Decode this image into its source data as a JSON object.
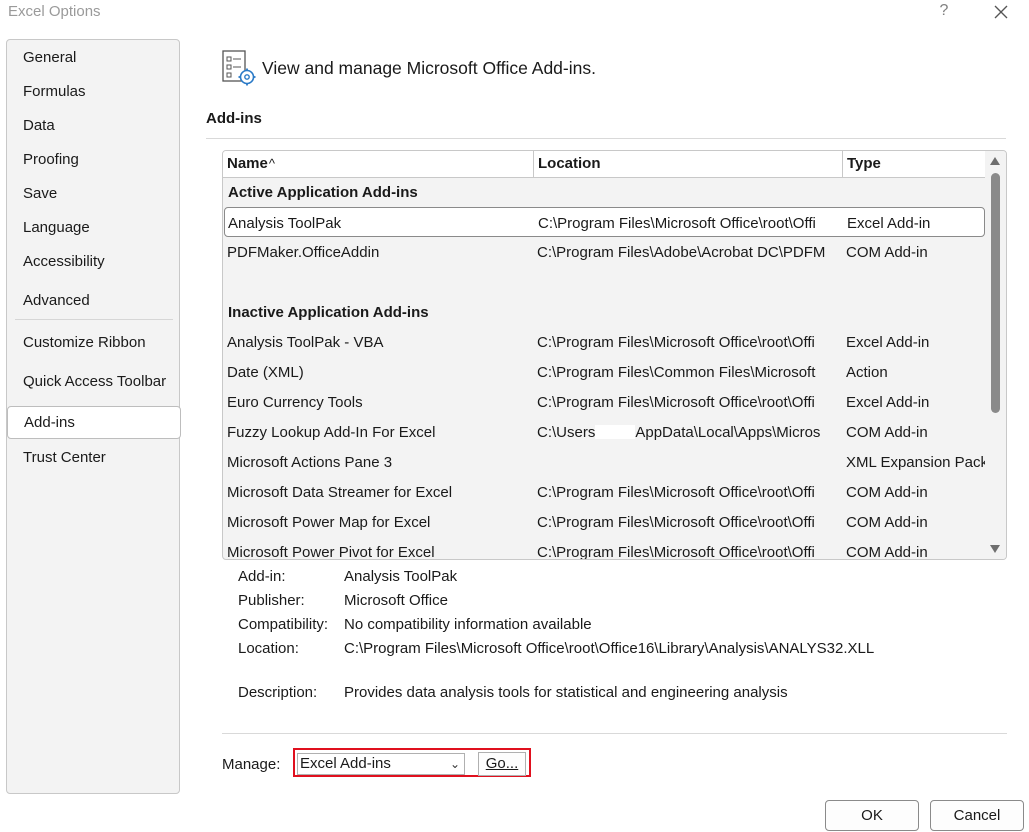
{
  "window": {
    "title": "Excel Options",
    "help": "?"
  },
  "sidebar": {
    "items": [
      {
        "label": "General"
      },
      {
        "label": "Formulas"
      },
      {
        "label": "Data"
      },
      {
        "label": "Proofing"
      },
      {
        "label": "Save"
      },
      {
        "label": "Language"
      },
      {
        "label": "Accessibility"
      },
      {
        "label": "Advanced"
      },
      {
        "label": "Customize Ribbon"
      },
      {
        "label": "Quick Access Toolbar"
      },
      {
        "label": "Add-ins"
      },
      {
        "label": "Trust Center"
      }
    ],
    "selected": "Add-ins"
  },
  "header": {
    "text": "View and manage Microsoft Office Add-ins."
  },
  "section": {
    "title": "Add-ins"
  },
  "grid": {
    "columns": [
      "Name",
      "Location",
      "Type"
    ],
    "sort_indicator": "^",
    "groups": {
      "active": "Active Application Add-ins",
      "inactive": "Inactive Application Add-ins"
    },
    "active_rows": [
      {
        "name": "Analysis ToolPak",
        "location": "C:\\Program Files\\Microsoft Office\\root\\Offi",
        "type": "Excel Add-in"
      },
      {
        "name": "PDFMaker.OfficeAddin",
        "location": "C:\\Program Files\\Adobe\\Acrobat DC\\PDFM",
        "type": "COM Add-in"
      }
    ],
    "inactive_rows": [
      {
        "name": "Analysis ToolPak - VBA",
        "location": "C:\\Program Files\\Microsoft Office\\root\\Offi",
        "type": "Excel Add-in"
      },
      {
        "name": "Date (XML)",
        "location": "C:\\Program Files\\Common Files\\Microsoft",
        "type": "Action"
      },
      {
        "name": "Euro Currency Tools",
        "location": "C:\\Program Files\\Microsoft Office\\root\\Offi",
        "type": "Excel Add-in"
      },
      {
        "name": "Fuzzy Lookup Add-In For Excel",
        "location_prefix": "C:\\Users",
        "location_suffix": "AppData\\Local\\Apps\\Micros",
        "type": "COM Add-in"
      },
      {
        "name": "Microsoft Actions Pane 3",
        "location": "",
        "type": "XML Expansion Pack"
      },
      {
        "name": "Microsoft Data Streamer for Excel",
        "location": "C:\\Program Files\\Microsoft Office\\root\\Offi",
        "type": "COM Add-in"
      },
      {
        "name": "Microsoft Power Map for Excel",
        "location": "C:\\Program Files\\Microsoft Office\\root\\Offi",
        "type": "COM Add-in"
      },
      {
        "name": "Microsoft Power Pivot for Excel",
        "location": "C:\\Program Files\\Microsoft Office\\root\\Offi",
        "type": "COM Add-in"
      }
    ]
  },
  "details": {
    "addin_label": "Add-in:",
    "addin_value": "Analysis ToolPak",
    "publisher_label": "Publisher:",
    "publisher_value": "Microsoft Office",
    "compat_label": "Compatibility:",
    "compat_value": "No compatibility information available",
    "location_label": "Location:",
    "location_value": "C:\\Program Files\\Microsoft Office\\root\\Office16\\Library\\Analysis\\ANALYS32.XLL",
    "description_label": "Description:",
    "description_value": "Provides data analysis tools for statistical and engineering analysis"
  },
  "manage": {
    "label": "Manage:",
    "selected": "Excel Add-ins",
    "go_label": "Go..."
  },
  "footer": {
    "ok_label": "OK",
    "cancel_label": "Cancel"
  },
  "colors": {
    "highlight": "#e0101e",
    "panel_bg": "#f3f3f3",
    "border": "#c8c8c8"
  },
  "icons": [
    "addins-manage-icon",
    "close-icon",
    "help-icon",
    "chevron-down-icon",
    "scroll-up-icon",
    "scroll-down-icon"
  ]
}
